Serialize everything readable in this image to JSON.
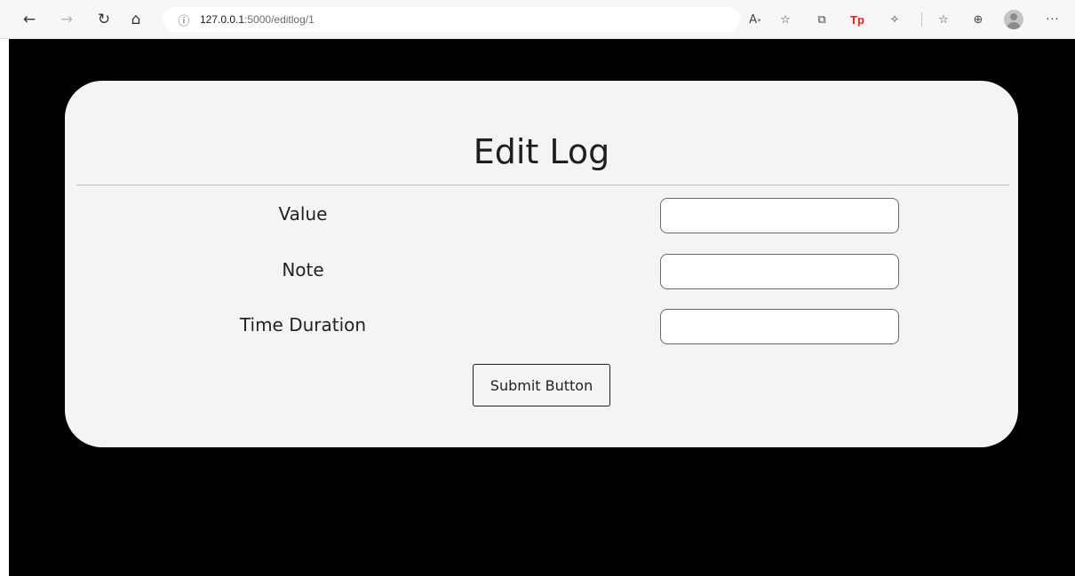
{
  "browser": {
    "url_host": "127.0.0.1",
    "url_path": ":5000/editlog/1",
    "icons": {
      "back": "←",
      "forward": "→",
      "refresh": "↻",
      "home": "⌂",
      "info": "ⓘ",
      "read_aloud": "A",
      "favorite_add": "☆",
      "extensions": "⧉",
      "tp_extension": "Tp",
      "puzzle": "✧",
      "favorites": "☆",
      "collections": "⊕",
      "more": "···"
    }
  },
  "form": {
    "title": "Edit Log",
    "fields": [
      {
        "label": "Value",
        "value": ""
      },
      {
        "label": "Note",
        "value": ""
      },
      {
        "label": "Time Duration",
        "value": ""
      }
    ],
    "submit_label": "Submit Button"
  },
  "colors": {
    "page_background": "#000000",
    "card_background": "#f4f4f4",
    "accent_tp": "#e0201b"
  }
}
